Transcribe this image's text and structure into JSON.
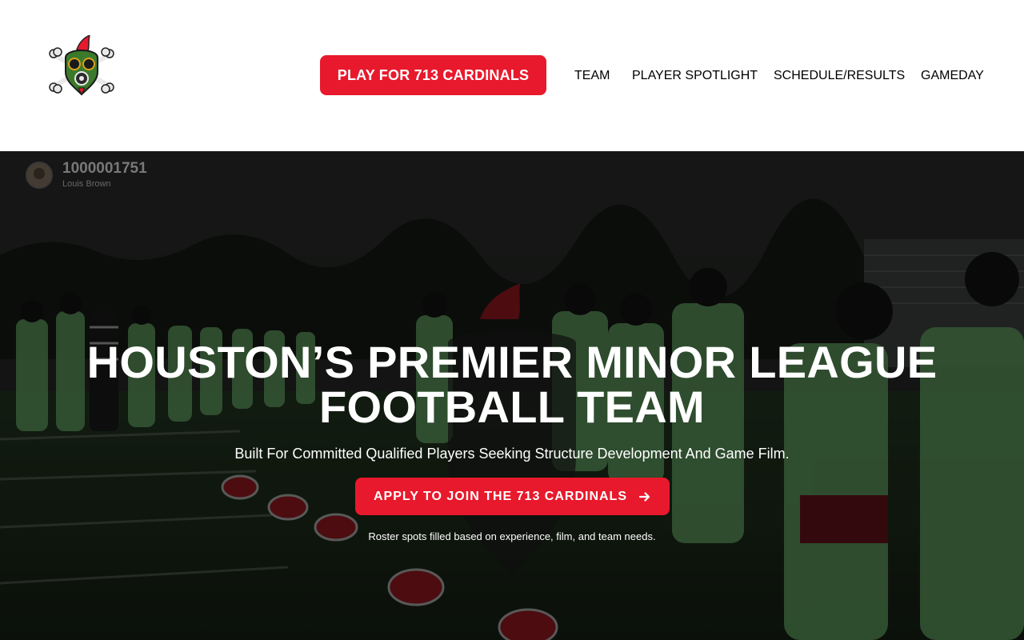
{
  "brand": {
    "logo_icon": "gas-mask-skull-logo",
    "accent_color": "#e8192c",
    "player_green": "#8be38a"
  },
  "header": {
    "cta_label": "PLAY FOR 713 CARDINALS",
    "nav": [
      {
        "label": "TEAM"
      },
      {
        "label": "PLAYER SPOTLIGHT"
      },
      {
        "label": "SCHEDULE/RESULTS"
      },
      {
        "label": "GAMEDAY"
      }
    ]
  },
  "hero": {
    "video_author": {
      "id": "1000001751",
      "name": "Louis Brown"
    },
    "title_line1": "HOUSTON’S PREMIER MINOR LEAGUE",
    "title_line2": "FOOTBALL TEAM",
    "subtitle": "Built For Committed Qualified Players Seeking Structure Development And Game Film.",
    "cta_label": "APPLY TO JOIN THE 713 CARDINALS",
    "cta_icon": "arrow-right-icon",
    "note": "Roster spots filled based on experience, film, and team needs."
  }
}
